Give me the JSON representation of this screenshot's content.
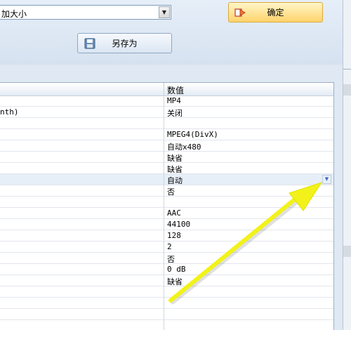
{
  "top": {
    "size_select_value": "加大小",
    "ok_label": "确定",
    "save_as_label": "另存为"
  },
  "grid": {
    "header_value": "数值",
    "rows": [
      {
        "name": "",
        "value": "MP4"
      },
      {
        "name": "nth)",
        "value": "关闭"
      },
      {
        "name": "",
        "value": ""
      },
      {
        "name": "",
        "value": "MPEG4(DivX)"
      },
      {
        "name": "",
        "value": "自动x480"
      },
      {
        "name": "",
        "value": "缺省"
      },
      {
        "name": "",
        "value": "缺省"
      },
      {
        "name": "",
        "value": "自动"
      },
      {
        "name": "",
        "value": "否"
      },
      {
        "name": "",
        "value": ""
      },
      {
        "name": "",
        "value": "AAC"
      },
      {
        "name": "",
        "value": "44100"
      },
      {
        "name": "",
        "value": "128"
      },
      {
        "name": "",
        "value": "2"
      },
      {
        "name": "",
        "value": "否"
      },
      {
        "name": "",
        "value": "0 dB"
      },
      {
        "name": "",
        "value": "缺省"
      },
      {
        "name": "",
        "value": ""
      },
      {
        "name": "",
        "value": ""
      },
      {
        "name": "",
        "value": ""
      },
      {
        "name": "",
        "value": ""
      }
    ]
  },
  "colors": {
    "annotation_arrow": "#f2f21a",
    "ok_button": "#ffd36b"
  }
}
